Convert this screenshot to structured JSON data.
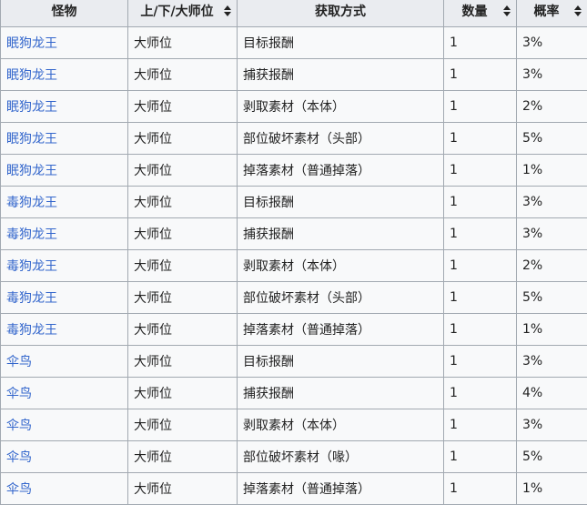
{
  "table": {
    "headers": [
      {
        "label": "怪物",
        "sortable": false
      },
      {
        "label": "上/下/大师位",
        "sortable": true
      },
      {
        "label": "获取方式",
        "sortable": false
      },
      {
        "label": "数量",
        "sortable": true
      },
      {
        "label": "概率",
        "sortable": true
      }
    ],
    "sort_icon": "sort-updown-icon",
    "link_color": "#3366cc",
    "rows": [
      {
        "monster": "眠狗龙王",
        "rank": "大师位",
        "method": "目标报酬",
        "quantity": "1",
        "rate": "3%"
      },
      {
        "monster": "眠狗龙王",
        "rank": "大师位",
        "method": "捕获报酬",
        "quantity": "1",
        "rate": "3%"
      },
      {
        "monster": "眠狗龙王",
        "rank": "大师位",
        "method": "剥取素材（本体）",
        "quantity": "1",
        "rate": "2%"
      },
      {
        "monster": "眠狗龙王",
        "rank": "大师位",
        "method": "部位破坏素材（头部）",
        "quantity": "1",
        "rate": "5%"
      },
      {
        "monster": "眠狗龙王",
        "rank": "大师位",
        "method": "掉落素材（普通掉落）",
        "quantity": "1",
        "rate": "1%"
      },
      {
        "monster": "毒狗龙王",
        "rank": "大师位",
        "method": "目标报酬",
        "quantity": "1",
        "rate": "3%"
      },
      {
        "monster": "毒狗龙王",
        "rank": "大师位",
        "method": "捕获报酬",
        "quantity": "1",
        "rate": "3%"
      },
      {
        "monster": "毒狗龙王",
        "rank": "大师位",
        "method": "剥取素材（本体）",
        "quantity": "1",
        "rate": "2%"
      },
      {
        "monster": "毒狗龙王",
        "rank": "大师位",
        "method": "部位破坏素材（头部）",
        "quantity": "1",
        "rate": "5%"
      },
      {
        "monster": "毒狗龙王",
        "rank": "大师位",
        "method": "掉落素材（普通掉落）",
        "quantity": "1",
        "rate": "1%"
      },
      {
        "monster": "伞鸟",
        "rank": "大师位",
        "method": "目标报酬",
        "quantity": "1",
        "rate": "3%"
      },
      {
        "monster": "伞鸟",
        "rank": "大师位",
        "method": "捕获报酬",
        "quantity": "1",
        "rate": "4%"
      },
      {
        "monster": "伞鸟",
        "rank": "大师位",
        "method": "剥取素材（本体）",
        "quantity": "1",
        "rate": "3%"
      },
      {
        "monster": "伞鸟",
        "rank": "大师位",
        "method": "部位破坏素材（喙）",
        "quantity": "1",
        "rate": "5%"
      },
      {
        "monster": "伞鸟",
        "rank": "大师位",
        "method": "掉落素材（普通掉落）",
        "quantity": "1",
        "rate": "1%"
      }
    ]
  }
}
